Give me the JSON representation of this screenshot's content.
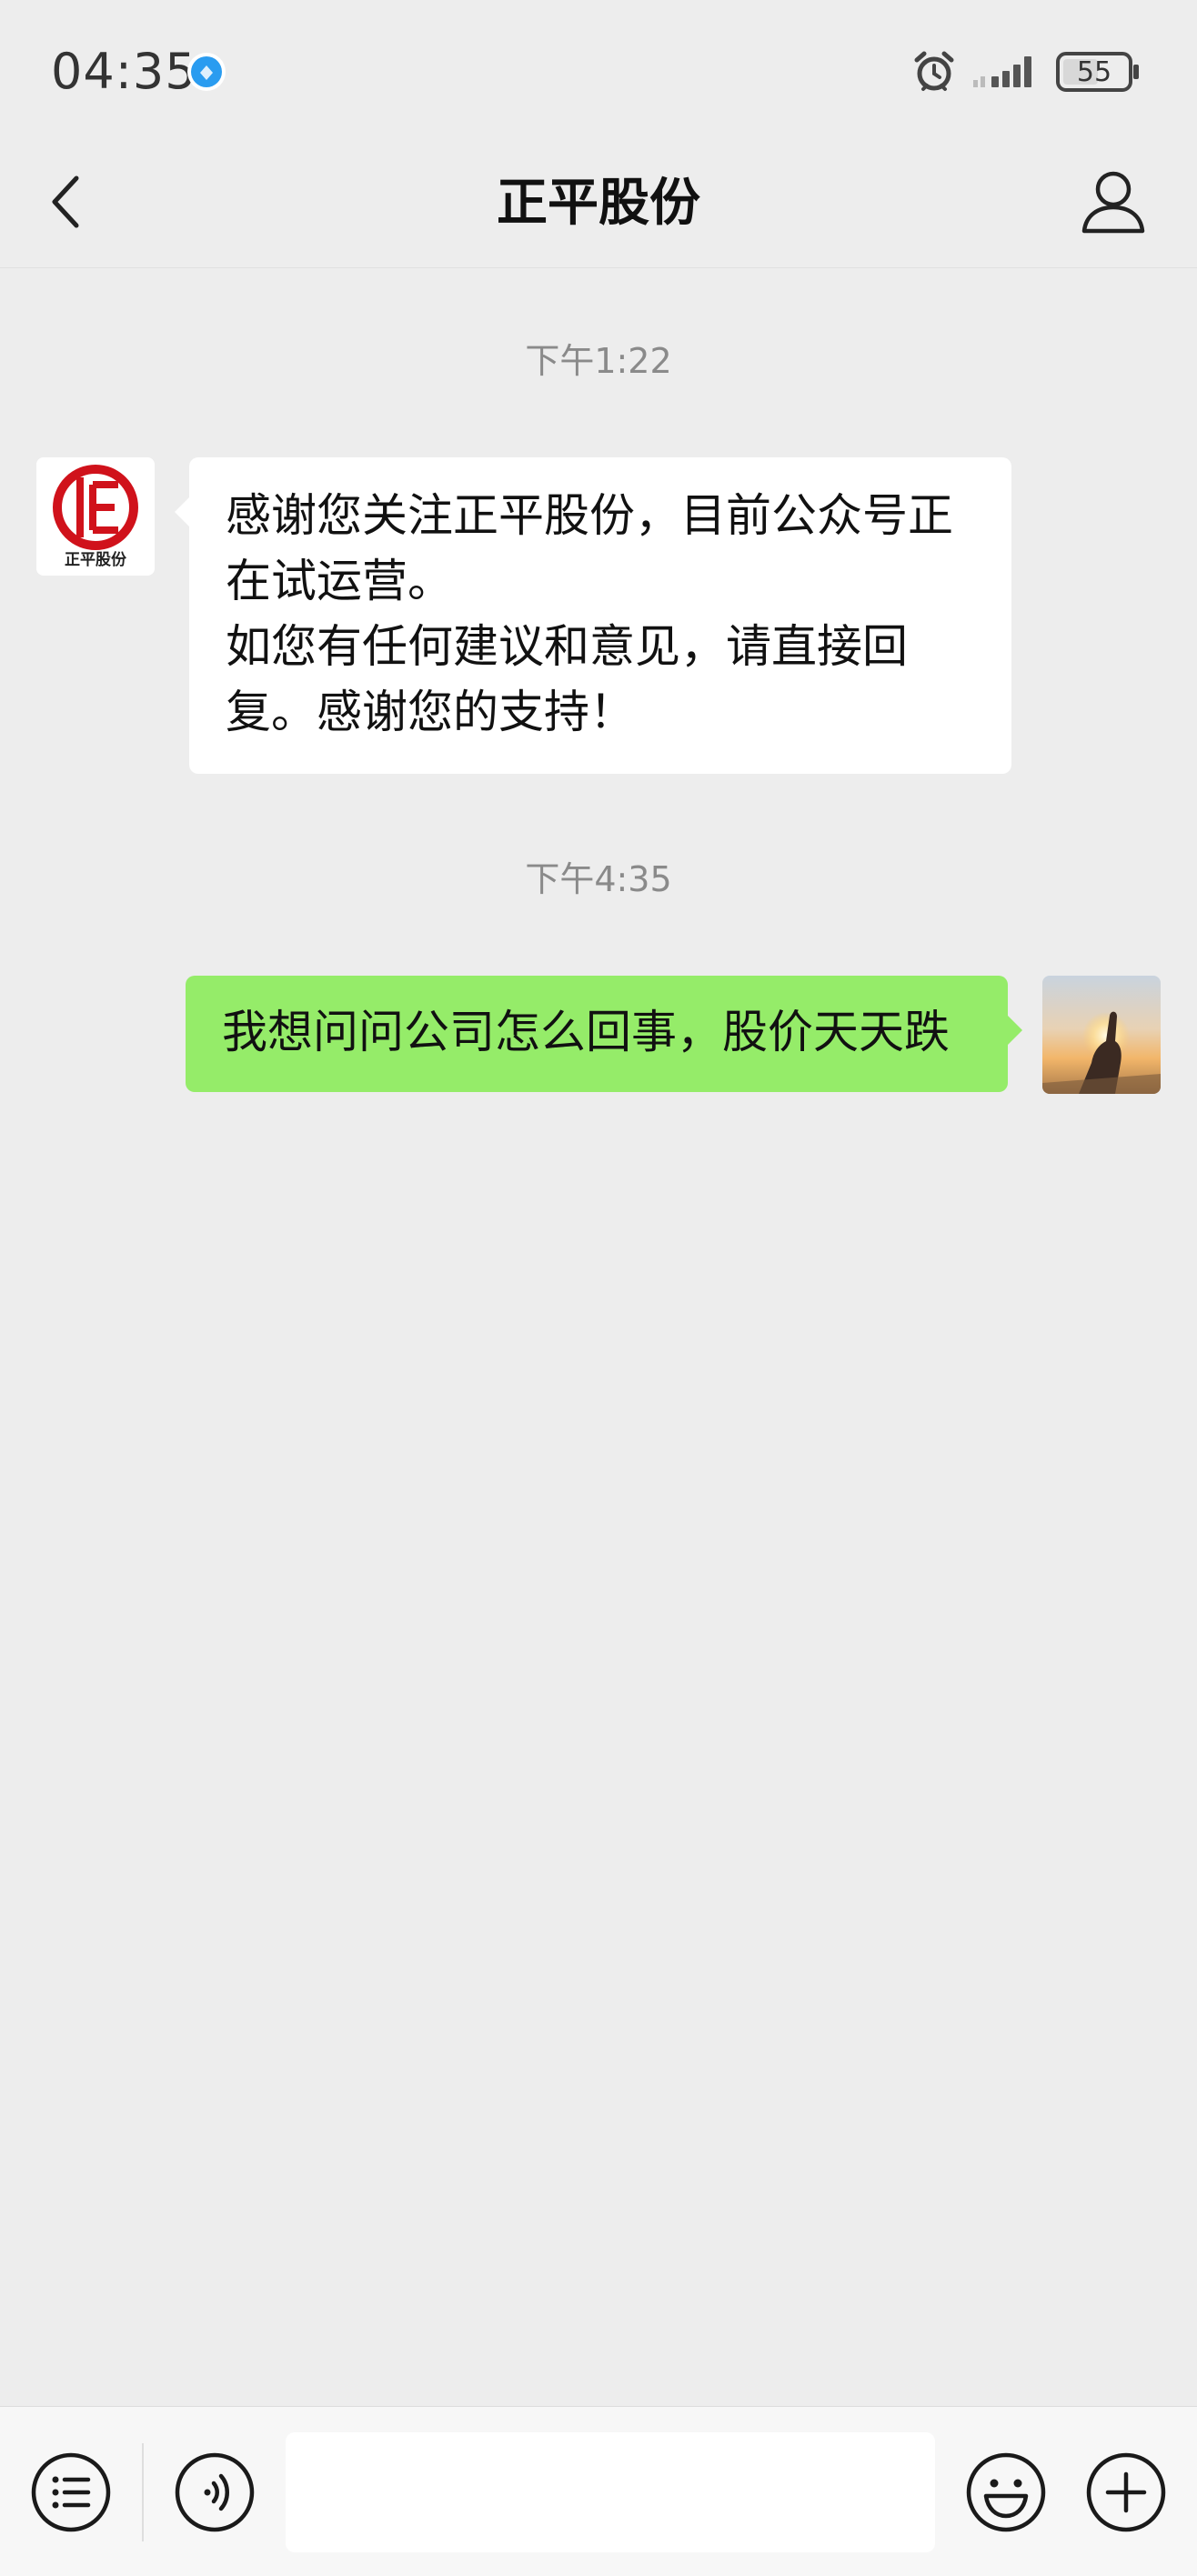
{
  "status_bar": {
    "time": "04:35",
    "battery": "55"
  },
  "header": {
    "title": "正平股份"
  },
  "messages": [
    {
      "timestamp": "下午1:22",
      "sender": "official-account",
      "avatar_text": "正平股份",
      "lines": [
        "感谢您关注正平股份，目前公众号正在试运营。",
        "如您有任何建议和意见，请直接回复。感谢您的支持！"
      ]
    },
    {
      "timestamp": "下午4:35",
      "sender": "me",
      "text": "我想问问公司怎么回事，股价天天跌"
    }
  ],
  "input_bar": {
    "placeholder": ""
  },
  "colors": {
    "background": "#ededed",
    "sent_bubble": "#95ec69",
    "received_bubble": "#ffffff",
    "logo_red": "#d0121b"
  },
  "icons": {
    "back": "chevron-left-icon",
    "profile": "person-icon",
    "menu": "list-icon",
    "voice": "voice-icon",
    "emoji": "emoji-icon",
    "more": "plus-icon"
  }
}
